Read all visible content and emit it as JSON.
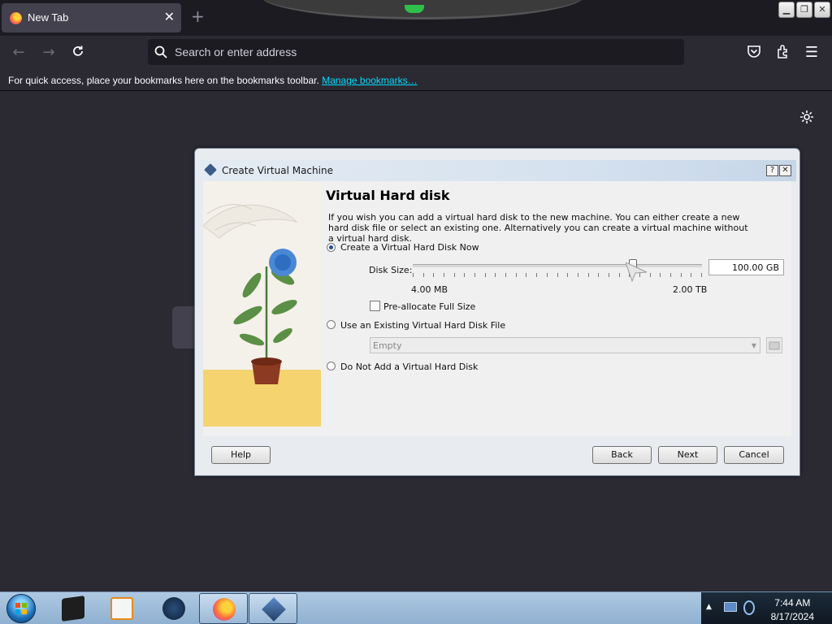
{
  "browser": {
    "tab_title": "New Tab",
    "address_placeholder": "Search or enter address",
    "bookmarks_message": "For quick access, place your bookmarks here on the bookmarks toolbar.",
    "bookmarks_link": "Manage bookmarks…"
  },
  "dialog": {
    "window_title": "Create Virtual Machine",
    "heading": "Virtual Hard disk",
    "description": "If you wish you can add a virtual hard disk to the new machine. You can either create a new hard disk file or select an existing one. Alternatively you can create a virtual machine without a virtual hard disk.",
    "options": {
      "create_now": "Create a Virtual Hard Disk Now",
      "use_existing": "Use an Existing Virtual Hard Disk File",
      "no_disk": "Do Not Add a Virtual Hard Disk"
    },
    "selected_option": "create_now",
    "disk_size_label": "Disk Size:",
    "disk_size_value": "100.00 GB",
    "slider_min_label": "4.00 MB",
    "slider_max_label": "2.00 TB",
    "slider_level": 0.76,
    "preallocate_label": "Pre-allocate Full Size",
    "preallocate_checked": false,
    "existing_file_value": "Empty",
    "buttons": {
      "help": "Help",
      "back": "Back",
      "next": "Next",
      "cancel": "Cancel"
    }
  },
  "taskbar": {
    "time": "7:44 AM",
    "date": "8/17/2024"
  },
  "colors": {
    "browser_bg": "#2b2a33",
    "link": "#00ddff",
    "taskbar": "#9ab9d7"
  }
}
